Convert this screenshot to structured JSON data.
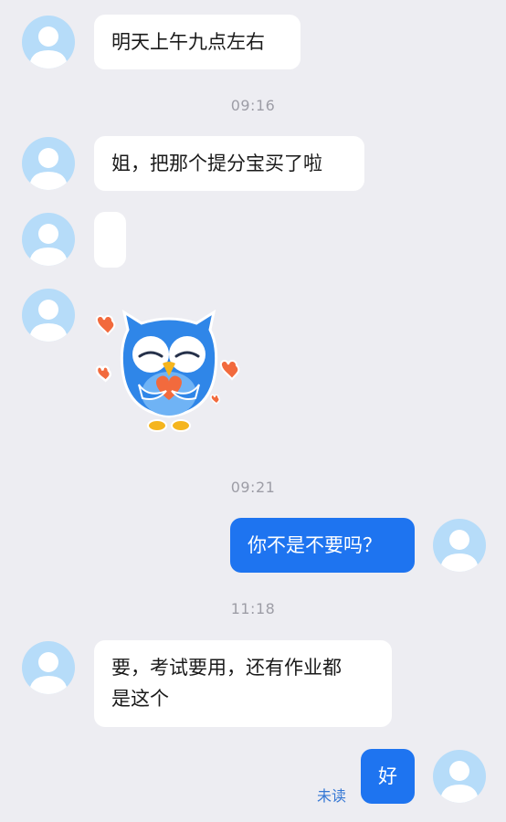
{
  "messages": {
    "m1": "明天上午九点左右",
    "m2": "姐，把那个提分宝买了啦",
    "m3": "",
    "m5": "你不是不要吗？",
    "m6_line1": "要，考试要用，还有作业都",
    "m6_line2": "是这个",
    "m7": "好"
  },
  "timestamps": {
    "t1": "09:16",
    "t2": "09:21",
    "t3": "11:18"
  },
  "status": {
    "unread_label": "未读"
  },
  "sticker": {
    "icon": "owl-hugging-heart-sticker",
    "colors": {
      "owl_blue": "#2f86e8",
      "heart": "#f26a3d",
      "beak": "#f5b51e"
    }
  },
  "colors": {
    "background": "#ededf2",
    "incoming_bubble": "#ffffff",
    "outgoing_bubble": "#1e74f0",
    "avatar": "#b6dcf9",
    "timestamp": "#9d9da6",
    "unread": "#3577d4"
  }
}
